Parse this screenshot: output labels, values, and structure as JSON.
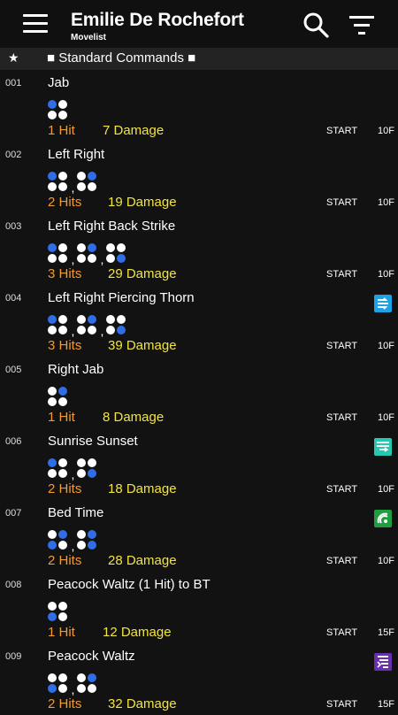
{
  "header": {
    "title": "Emilie De Rochefort",
    "subtitle": "Movelist"
  },
  "section": {
    "star": "★",
    "title": "■ Standard Commands ■"
  },
  "colors": {
    "hits": "#f39a33",
    "damage": "#f2e442",
    "button_pressed": "#2f6ee6",
    "heat_engager": "#1da1e8",
    "power_crush": "#25c9b0",
    "homing": "#1f9e3f",
    "tornado": "#6a2fb0"
  },
  "moves": [
    {
      "num": "001",
      "name": "Jab",
      "cmd": [
        [
          1,
          0,
          0,
          0
        ]
      ],
      "hits": "1 Hit",
      "damage": "7 Damage",
      "start": "START",
      "frames": "10F",
      "icon": null
    },
    {
      "num": "002",
      "name": "Left Right",
      "cmd": [
        [
          1,
          0,
          0,
          0
        ],
        [
          0,
          1,
          0,
          0
        ]
      ],
      "hits": "2 Hits",
      "damage": "19 Damage",
      "start": "START",
      "frames": "10F",
      "icon": null
    },
    {
      "num": "003",
      "name": "Left Right Back Strike",
      "cmd": [
        [
          1,
          0,
          0,
          0
        ],
        [
          0,
          1,
          0,
          0
        ],
        [
          0,
          0,
          0,
          1
        ]
      ],
      "hits": "3 Hits",
      "damage": "29 Damage",
      "start": "START",
      "frames": "10F",
      "icon": null
    },
    {
      "num": "004",
      "name": "Left Right Piercing Thorn",
      "cmd": [
        [
          1,
          0,
          0,
          0
        ],
        [
          0,
          1,
          0,
          0
        ],
        [
          0,
          0,
          0,
          1
        ]
      ],
      "hits": "3 Hits",
      "damage": "39 Damage",
      "start": "START",
      "frames": "10F",
      "icon": "heat-engager-icon"
    },
    {
      "num": "005",
      "name": "Right Jab",
      "cmd": [
        [
          0,
          1,
          0,
          0
        ]
      ],
      "hits": "1 Hit",
      "damage": "8 Damage",
      "start": "START",
      "frames": "10F",
      "icon": null
    },
    {
      "num": "006",
      "name": "Sunrise Sunset",
      "cmd": [
        [
          1,
          0,
          0,
          0
        ],
        [
          0,
          0,
          0,
          1
        ]
      ],
      "hits": "2 Hits",
      "damage": "18 Damage",
      "start": "START",
      "frames": "10F",
      "icon": "power-crush-icon"
    },
    {
      "num": "007",
      "name": "Bed Time",
      "cmd": [
        [
          0,
          1,
          1,
          0
        ],
        [
          0,
          1,
          0,
          1
        ]
      ],
      "hits": "2 Hits",
      "damage": "28 Damage",
      "start": "START",
      "frames": "10F",
      "icon": "homing-icon"
    },
    {
      "num": "008",
      "name": "Peacock Waltz (1 Hit) to BT",
      "cmd": [
        [
          0,
          0,
          1,
          0
        ]
      ],
      "hits": "1 Hit",
      "damage": "12 Damage",
      "start": "START",
      "frames": "15F",
      "icon": null
    },
    {
      "num": "009",
      "name": "Peacock Waltz",
      "cmd": [
        [
          0,
          0,
          1,
          0
        ],
        [
          0,
          1,
          0,
          0
        ]
      ],
      "hits": "2 Hits",
      "damage": "32 Damage",
      "start": "START",
      "frames": "15F",
      "icon": "tornado-icon"
    }
  ]
}
